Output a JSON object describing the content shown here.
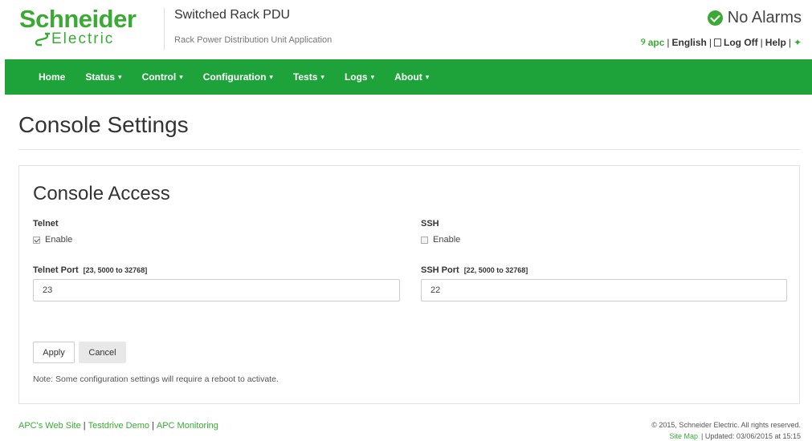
{
  "brand": {
    "logo_line1": "Schneider",
    "logo_line2": "Electric",
    "product": "Switched Rack PDU",
    "application": "Rack Power Distribution Unit Application"
  },
  "alarms": {
    "text": "No Alarms",
    "icon": "check-circle-icon",
    "color": "#3aaa35"
  },
  "toplinks": {
    "apc": "apc",
    "language": "English",
    "logoff": "Log Off",
    "help": "Help"
  },
  "nav": {
    "color": "#1ea33a",
    "items": [
      {
        "label": "Home",
        "caret": ""
      },
      {
        "label": "Status",
        "caret": "▾"
      },
      {
        "label": "Control",
        "caret": "▾"
      },
      {
        "label": "Configuration",
        "caret": "▾"
      },
      {
        "label": "Tests",
        "caret": "▾"
      },
      {
        "label": "Logs",
        "caret": "▾"
      },
      {
        "label": "About",
        "caret": "▾"
      }
    ]
  },
  "page": {
    "title": "Console Settings"
  },
  "console_access": {
    "title": "Console Access",
    "telnet": {
      "label": "Telnet",
      "enable_label": "Enable",
      "enabled": true,
      "port_label": "Telnet Port",
      "port_range": "[23, 5000 to 32768]",
      "port_value": "23"
    },
    "ssh": {
      "label": "SSH",
      "enable_label": "Enable",
      "enabled": false,
      "port_label": "SSH Port",
      "port_range": "[22, 5000 to 32768]",
      "port_value": "22"
    },
    "apply_label": "Apply",
    "cancel_label": "Cancel",
    "note": "Note: Some configuration settings will require a reboot to activate."
  },
  "footer": {
    "links": [
      "APC's Web Site",
      "Testdrive Demo",
      "APC Monitoring"
    ],
    "copyright": "© 2015, Schneider Electric. All rights reserved.",
    "site_map": "Site Map",
    "updated": "| Updated: 03/06/2015 at 15:15"
  }
}
